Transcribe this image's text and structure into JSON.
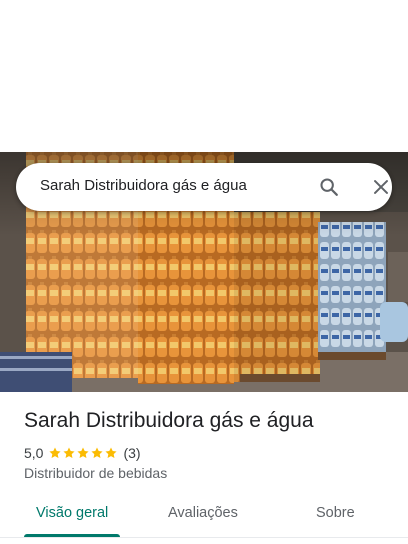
{
  "search": {
    "query": "Sarah Distribuidora gás e água"
  },
  "place": {
    "name": "Sarah Distribuidora gás e água",
    "rating": "5,0",
    "stars": 5,
    "review_count": "(3)",
    "category": "Distribuidor de bebidas"
  },
  "tabs": [
    {
      "label": "Visão geral",
      "active": true
    },
    {
      "label": "Avaliações",
      "active": false
    },
    {
      "label": "Sobre",
      "active": false
    }
  ],
  "icons": {
    "search": "search-icon",
    "close": "close-icon",
    "star": "star-icon"
  },
  "colors": {
    "accent": "#00796b",
    "star": "#fbbc04",
    "text": "#202124",
    "secondary_text": "#5f6368"
  }
}
